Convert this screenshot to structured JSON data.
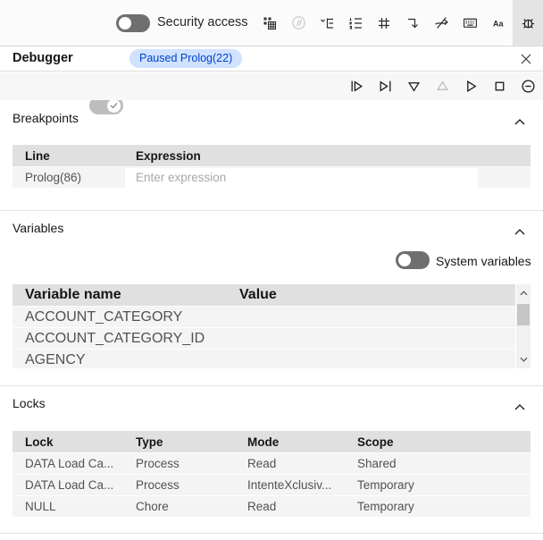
{
  "toolbar": {
    "security_label": "Security access",
    "security_toggle_on": false,
    "icons": [
      "data-grid",
      "function",
      "tree-view",
      "list-numbered",
      "hash",
      "move-down",
      "skip-arrow",
      "keyboard",
      "text-style",
      "debug"
    ],
    "selected_icon": "debug"
  },
  "debugger_header": {
    "title": "Debugger",
    "toggle_on": true,
    "status_badge": "Paused Prolog(22)",
    "badge_bg": "#d0e2ff",
    "badge_text_color": "#0043ce"
  },
  "controls": {
    "buttons": [
      "play-from-start",
      "play-to-end",
      "step-into",
      "step-out",
      "resume",
      "stop",
      "suspend"
    ],
    "disabled": [
      "step-out"
    ]
  },
  "sections": {
    "breakpoints": {
      "title": "Breakpoints",
      "columns": [
        "Line",
        "Expression"
      ],
      "rows": [
        {
          "line": "Prolog(86)",
          "expression_value": "",
          "expression_placeholder": "Enter expression"
        }
      ]
    },
    "variables": {
      "title": "Variables",
      "system_toggle_label": "System variables",
      "system_toggle_on": false,
      "columns": [
        "Variable name",
        "Value"
      ],
      "rows": [
        {
          "name": "ACCOUNT_CATEGORY",
          "value": ""
        },
        {
          "name": "ACCOUNT_CATEGORY_ID",
          "value": ""
        },
        {
          "name": "AGENCY",
          "value": ""
        }
      ]
    },
    "locks": {
      "title": "Locks",
      "columns": [
        "Lock",
        "Type",
        "Mode",
        "Scope"
      ],
      "rows": [
        {
          "cells": [
            "DATA Load Ca...",
            "Process",
            "Read",
            "Shared"
          ]
        },
        {
          "cells": [
            "DATA Load Ca...",
            "Process",
            "IntenteXclusiv...",
            "Temporary"
          ]
        },
        {
          "cells": [
            "NULL",
            "Chore",
            "Read",
            "Temporary"
          ]
        }
      ]
    }
  },
  "colors": {
    "table_header_bg": "#e0e0e0",
    "table_row_bg": "#f4f4f4",
    "toolbar_bg": "#fbfbfb",
    "controls_bg": "#f7f7f7",
    "badge_bg": "#d0e2ff",
    "badge_text": "#0043ce",
    "text_primary": "#161616",
    "text_secondary": "#525252",
    "placeholder": "#a8a8a8"
  }
}
